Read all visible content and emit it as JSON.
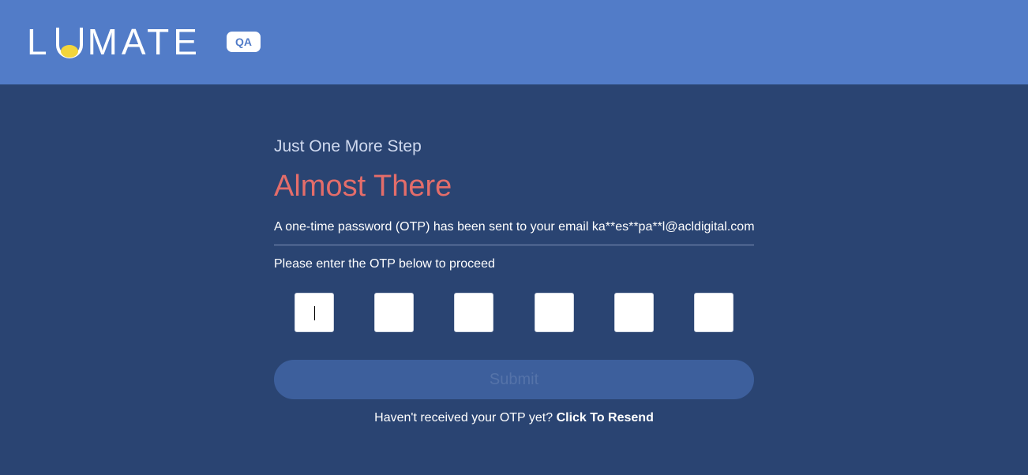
{
  "header": {
    "logo_text_start": "L",
    "logo_text_end": "MATE",
    "logo_accent_color": "#f2d53c",
    "badge": "QA"
  },
  "main": {
    "step_text": "Just One More Step",
    "title": "Almost There",
    "sent_message": "A one-time password (OTP) has been sent to your email ka**es**pa**l@acldigital.com",
    "prompt": "Please enter the OTP below to proceed",
    "otp_fields": [
      "",
      "",
      "",
      "",
      "",
      ""
    ],
    "submit_label": "Submit",
    "resend_prefix": "Haven't received your OTP yet? ",
    "resend_link": "Click To Resend"
  },
  "colors": {
    "header_bg": "#527cc8",
    "page_bg": "#2a4472",
    "title": "#e46d6a",
    "submit_bg": "#3d5f9c"
  }
}
